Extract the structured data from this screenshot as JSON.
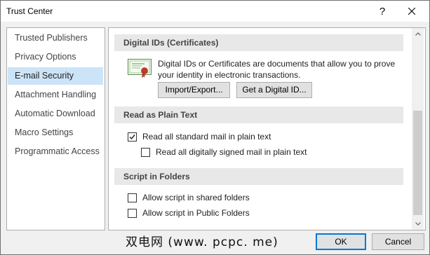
{
  "window": {
    "title": "Trust Center",
    "help_label": "?",
    "close_label": "✕"
  },
  "nav": {
    "items": [
      {
        "label": "Trusted Publishers"
      },
      {
        "label": "Privacy Options"
      },
      {
        "label": "E-mail Security",
        "selected": true
      },
      {
        "label": "Attachment Handling"
      },
      {
        "label": "Automatic Download"
      },
      {
        "label": "Macro Settings"
      },
      {
        "label": "Programmatic Access"
      }
    ]
  },
  "digital_ids": {
    "header": "Digital IDs (Certificates)",
    "description": "Digital IDs or Certificates are documents that allow you to prove your identity in electronic transactions.",
    "import_export_button": "Import/Export...",
    "get_digital_id_button": "Get a Digital ID..."
  },
  "plain_text": {
    "header": "Read as Plain Text",
    "read_standard_label": "Read all standard mail in plain text",
    "read_standard_checked": true,
    "read_signed_label": "Read all digitally signed mail in plain text",
    "read_signed_checked": false
  },
  "script_folders": {
    "header": "Script in Folders",
    "shared_label": "Allow script in shared folders",
    "shared_checked": false,
    "public_label": "Allow script in Public Folders",
    "public_checked": false
  },
  "footer": {
    "watermark": "双电网 (www. pcpc. me)",
    "ok_label": "OK",
    "cancel_label": "Cancel"
  }
}
